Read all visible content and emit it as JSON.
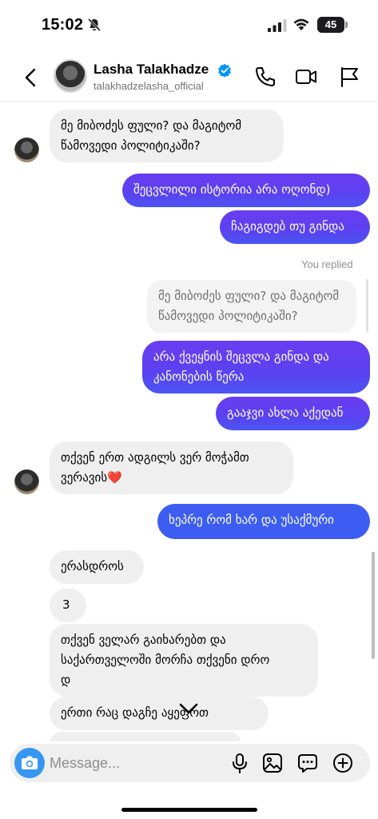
{
  "status_bar": {
    "time": "15:02",
    "battery": "45",
    "battery_level": 0.45
  },
  "header": {
    "name": "Lasha Talakhadze",
    "username": "talakhadzelasha_official",
    "icons": [
      "back-icon",
      "verified-icon",
      "phone-icon",
      "video-icon",
      "flag-icon"
    ]
  },
  "messages": [
    {
      "from": "them",
      "text": "მე მიბოძეს ფული? და მაგიტომ\nწამოვედი პოლიტიკაში?"
    },
    {
      "from": "me",
      "text": "შეცვლილი ისტორია არა ოღონდ)"
    },
    {
      "from": "me",
      "text": "ჩაგიგდებ თუ გინდა"
    },
    {
      "from": "me",
      "label": "You replied"
    },
    {
      "from": "quote",
      "text": "მე მიბოძეს ფული? და მაგიტომ\nწამოვედი პოლიტიკაში?"
    },
    {
      "from": "me",
      "text": "არა ქვეყნის შეცვლა გინდა და\nკანონების წერა"
    },
    {
      "from": "me",
      "text": "გააჯვი ახლა აქედან"
    },
    {
      "from": "them",
      "text": "თქვენ ერთ ადგილს ვერ მოჭამთ\nვერავის❤️"
    },
    {
      "from": "me",
      "text": "ხეპრე რომ ხარ და უსაქმური"
    },
    {
      "from": "them",
      "text": "ერასდროს"
    },
    {
      "from": "them",
      "text": "3"
    },
    {
      "from": "them",
      "text": "თქვენ ველარ გაიხარებთ და\nსაქართველოში მორჩა თქვენი დრო\nდ"
    },
    {
      "from": "them",
      "text": "ერთი რაც დაგჩე    აყეფოთ"
    }
  ],
  "composer": {
    "placeholder": "Message...",
    "icons": [
      "camera-icon",
      "microphone-icon",
      "image-icon",
      "sticker-icon",
      "plus-icon"
    ]
  },
  "colors": {
    "outgoing_purple": "#5a42f0",
    "outgoing_blue": "#3d5df2",
    "incoming": "#efefef",
    "camera_button": "#3797f0",
    "verified": "#0095f6"
  }
}
